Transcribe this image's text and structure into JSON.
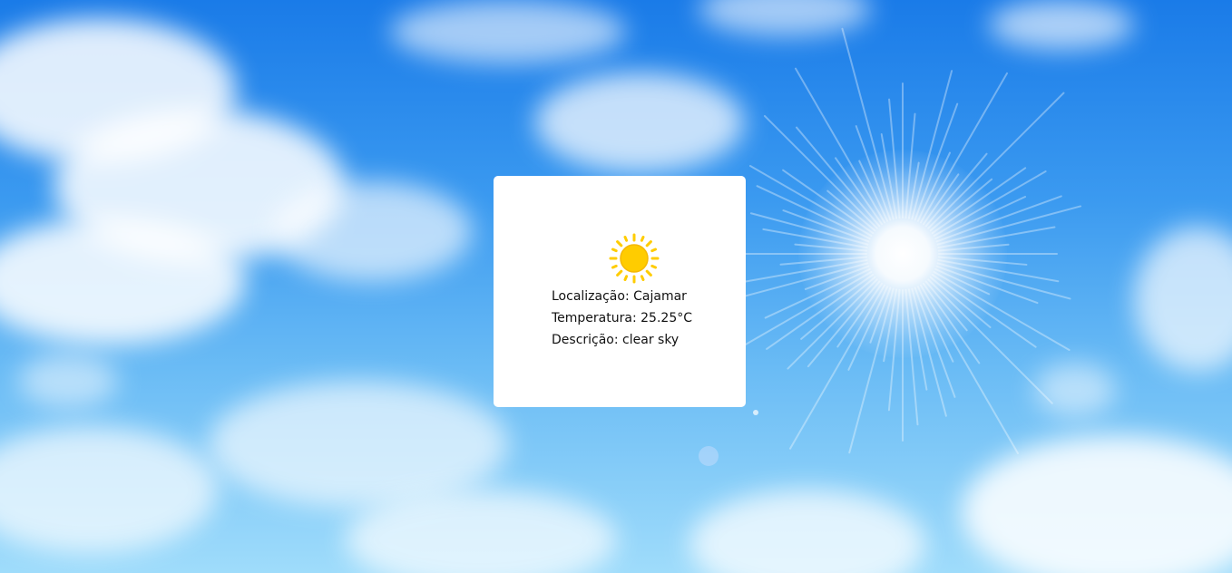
{
  "weather": {
    "icon": "sun-icon",
    "location_label": "Localização:",
    "location_value": "Cajamar",
    "temperature_label": "Temperatura:",
    "temperature_value": "25.25°C",
    "description_label": "Descrição:",
    "description_value": "clear sky"
  },
  "colors": {
    "card_background": "#ffffff",
    "sun_icon": "#ffcc00",
    "sky_top": "#1a7be8",
    "sky_bottom": "#9fdcfb"
  }
}
